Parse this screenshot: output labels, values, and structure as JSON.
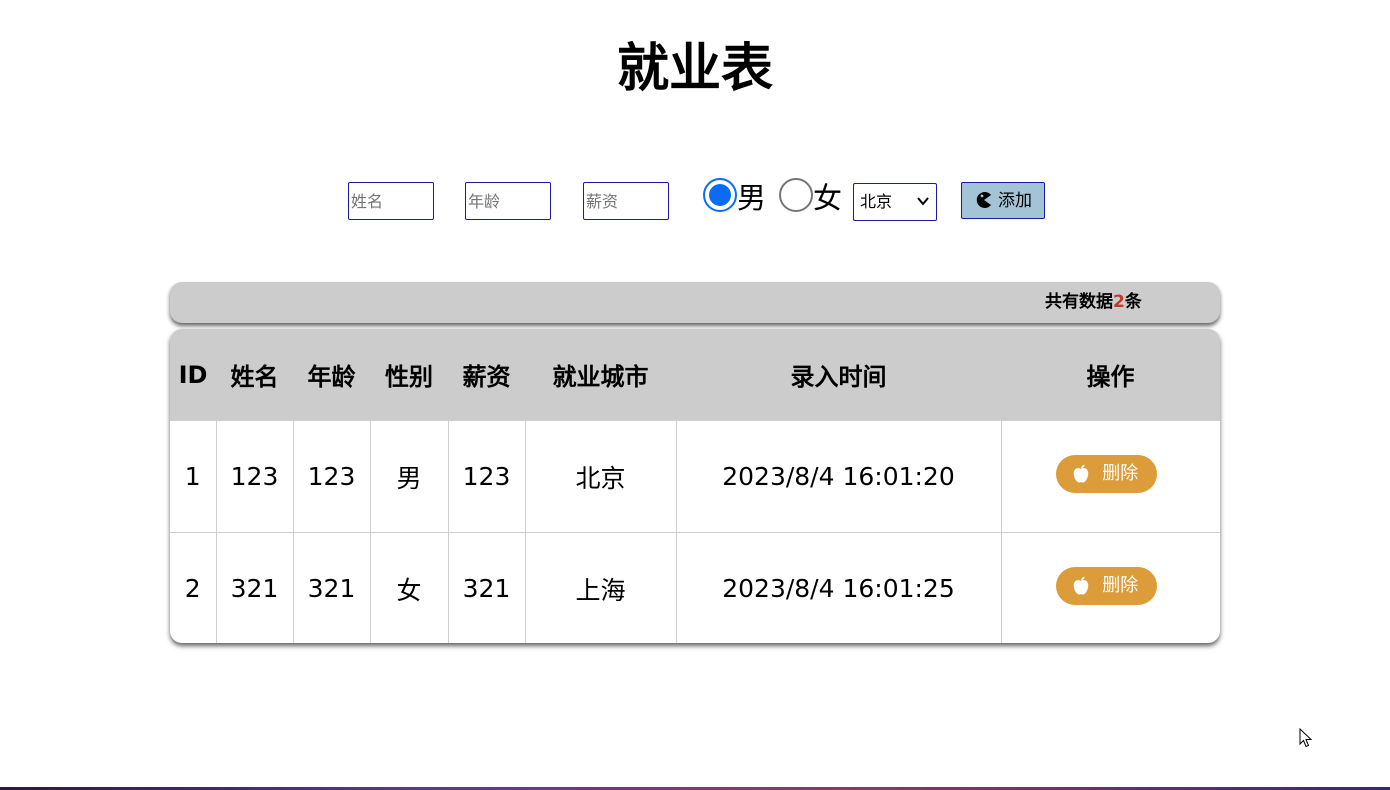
{
  "page": {
    "title": "就业表"
  },
  "form": {
    "name_placeholder": "姓名",
    "age_placeholder": "年龄",
    "salary_placeholder": "薪资",
    "gender_options": [
      {
        "label": "男",
        "checked": true
      },
      {
        "label": "女",
        "checked": false
      }
    ],
    "city_selected": "北京",
    "add_button_label": "添加"
  },
  "summary": {
    "prefix": "共有数据",
    "count": "2",
    "suffix": "条"
  },
  "table": {
    "headers": [
      "ID",
      "姓名",
      "年龄",
      "性别",
      "薪资",
      "就业城市",
      "录入时间",
      "操作"
    ],
    "rows": [
      {
        "id": "1",
        "name": "123",
        "age": "123",
        "gender": "男",
        "salary": "123",
        "city": "北京",
        "time": "2023/8/4 16:01:20",
        "action": "删除"
      },
      {
        "id": "2",
        "name": "321",
        "age": "321",
        "gender": "女",
        "salary": "321",
        "city": "上海",
        "time": "2023/8/4 16:01:25",
        "action": "删除"
      }
    ]
  },
  "colors": {
    "accent_blue": "#0a6cf5",
    "input_border": "#1a1aa6",
    "add_button_bg": "#a3c4d7",
    "delete_button_bg": "#dc9c3a",
    "header_bg": "#cccccc",
    "count_color": "#c0392b"
  },
  "icons": {
    "add_button_icon": "pacman-icon",
    "delete_button_icon": "apple-icon",
    "select_icon": "chevron-down-icon"
  }
}
